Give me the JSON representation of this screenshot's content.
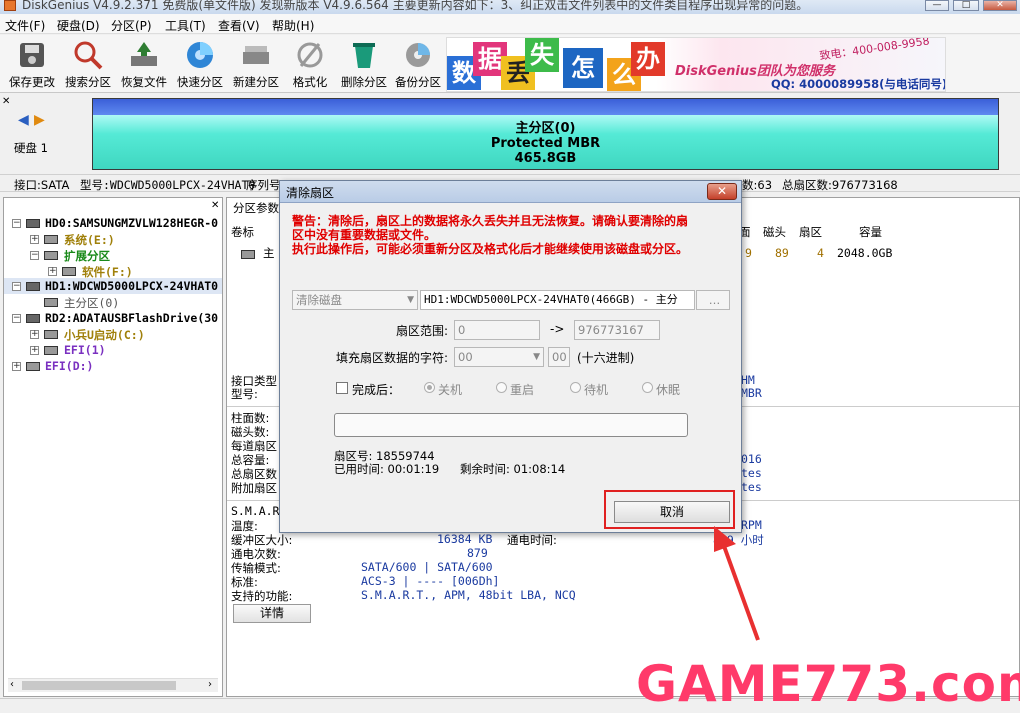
{
  "app": {
    "title": "DiskGenius V4.9.2.371 免费版(单文件版)   发现新版本 V4.9.6.564 主要更新内容如下：3、纠正双击文件列表中的文件类目程序出现异常的问题。",
    "min_label": "—",
    "max_label": "□",
    "close_label": "✕"
  },
  "menu": [
    "文件(F)",
    "硬盘(D)",
    "分区(P)",
    "工具(T)",
    "查看(V)",
    "帮助(H)"
  ],
  "toolbar": [
    {
      "label": "保存更改",
      "icon": "save-icon"
    },
    {
      "label": "搜索分区",
      "icon": "search-icon"
    },
    {
      "label": "恢复文件",
      "icon": "recover-icon"
    },
    {
      "label": "快速分区",
      "icon": "quick-partition-icon"
    },
    {
      "label": "新建分区",
      "icon": "new-partition-icon"
    },
    {
      "label": "格式化",
      "icon": "format-icon"
    },
    {
      "label": "删除分区",
      "icon": "delete-icon"
    },
    {
      "label": "备份分区",
      "icon": "backup-icon"
    }
  ],
  "banner": {
    "chars": [
      "数",
      "据",
      "丢",
      "失",
      "怎",
      "么",
      "办"
    ],
    "brand": "DiskGenius团队为您服务",
    "phone": "致电：400-008-9958",
    "qq": "QQ: 4000089958(与电话同号)"
  },
  "disk": {
    "label": "硬盘 1",
    "part_name": "主分区(0)",
    "part_type": "Protected MBR",
    "part_size": "465.8GB"
  },
  "infoline": {
    "iface": "接口:SATA",
    "model": "型号:WDCWD5000LPCX-24VHAT0",
    "serial": "序列号",
    "sectors_per_track": "数:63",
    "total_sectors": "总扇区数:976773168"
  },
  "tree": [
    {
      "label": "HD0:SAMSUNGMZVLW128HEGR-0",
      "color": "#000000"
    },
    {
      "label": "系统(E:)",
      "color": "#a0800a"
    },
    {
      "label": "扩展分区",
      "color": "#1a8a1a"
    },
    {
      "label": "软件(F:)",
      "color": "#a0800a"
    },
    {
      "label": "HD1:WDCWD5000LPCX-24VHAT0",
      "color": "#000000"
    },
    {
      "label": "主分区(0)",
      "color": "#555555"
    },
    {
      "label": "RD2:ADATAUSBFlashDrive(30",
      "color": "#000000"
    },
    {
      "label": "小兵U启动(C:)",
      "color": "#a0800a"
    },
    {
      "label": "EFI(1)",
      "color": "#7a30c0"
    },
    {
      "label": "EFI(D:)",
      "color": "#7a30c0"
    }
  ],
  "right": {
    "tab": "分区参数",
    "col_vol": "卷标",
    "col_face": "面",
    "col_head": "磁头",
    "col_sector": "扇区",
    "col_cap": "容量",
    "row_name": "主",
    "row_face": "9",
    "row_head": "89",
    "row_sector": "4",
    "row_cap": "2048.0GB",
    "iface_type": "接口类型",
    "model": "型号:",
    "cyl": "柱面数:",
    "heads": "磁头数:",
    "spt": "每道扇区",
    "total_cap": "总容量:",
    "total_sec": "总扇区数",
    "extra_sec": "附加扇区",
    "r_hm": "HM",
    "r_mbr": "MBR",
    "r_016": "016",
    "r_tes1": "tes",
    "r_tes2": "tes",
    "smart": "S.M.A.R.",
    "temp": "温度:",
    "rpm": "RPM",
    "cache": "缓冲区大小:",
    "cache_val": "16384 KB",
    "power_time": "通电时间:",
    "power_time_val": "869 小时",
    "power_count": "通电次数:",
    "power_count_val": "879",
    "transfer": "传输模式:",
    "transfer_val": "SATA/600 | SATA/600",
    "standard": "标准:",
    "standard_val": "ACS-3 | ---- [006Dh]",
    "features": "支持的功能:",
    "features_val": "S.M.A.R.T., APM, 48bit LBA, NCQ",
    "detail_btn": "详情"
  },
  "dialog": {
    "title": "清除扇区",
    "warn1": "警告：清除后，扇区上的数据将永久丢失并且无法恢复。请确认要清除的扇",
    "warn2": "区中没有重要数据或文件。",
    "warn3": "执行此操作后，可能必须重新分区及格式化后才能继续使用该磁盘或分区。",
    "mode": "清除磁盘",
    "target": "HD1:WDCWD5000LPCX-24VHAT0(466GB) - 主分",
    "range_label": "扇区范围:",
    "range_from": "0",
    "range_arrow": "->",
    "range_to": "976773167",
    "fill_label": "填充扇区数据的字符:",
    "fill_sel": "00",
    "fill_val": "00",
    "fill_hint": "(十六进制)",
    "done_label": "完成后：",
    "opt_shutdown": "关机",
    "opt_restart": "重启",
    "opt_standby": "待机",
    "opt_hibernate": "休眠",
    "sector_no": "扇区号: 18559744",
    "elapsed": "已用时间: 00:01:19",
    "remaining": "剩余时间: 01:08:14",
    "cancel": "取消"
  },
  "watermark": "GAME773.com"
}
